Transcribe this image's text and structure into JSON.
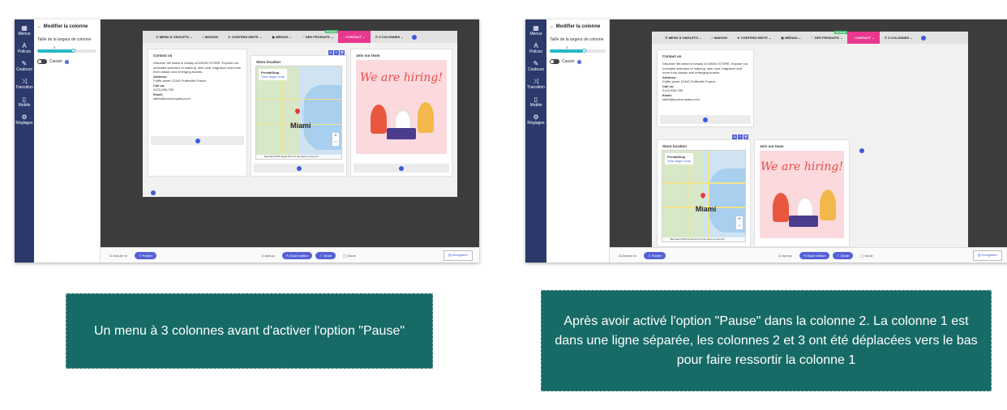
{
  "nav": [
    {
      "icon": "grid-icon",
      "glyph": "▦",
      "label": "Menus"
    },
    {
      "icon": "font-icon",
      "glyph": "A",
      "label": "Polices"
    },
    {
      "icon": "brush-icon",
      "glyph": "✎",
      "label": "Couleurs"
    },
    {
      "icon": "shuffle-icon",
      "glyph": "⤨",
      "label": "Transition"
    },
    {
      "icon": "mobile-icon",
      "glyph": "▯",
      "label": "Mobile"
    },
    {
      "icon": "gear-icon",
      "glyph": "⚙",
      "label": "Réglages"
    }
  ],
  "config": {
    "back_label": "← Modifier la colonne",
    "width_label": "Taille de la largeur de colonne",
    "width_value": "4",
    "width_fraction": 0.6,
    "break_label": "Casser"
  },
  "menu": {
    "items": [
      "☰ MENU À ONGLETS ⌄",
      "⌂ MAISON",
      "★ CONTENU MIXTE ⌄",
      "▣ MÉDIAS ⌄",
      "♡ DES PRODUITS ⌄",
      "◌ CONTACT ⌄",
      "☰ 3 COLONNES ⌄"
    ],
    "badge": "Nouveau"
  },
  "contact": {
    "title": "Contact us",
    "intro": "Discover the latest in beauty at DEMO STORE. Explore our unrivaled selection of makeup, skin care, fragrance and more from classic and emerging brands.",
    "address_label": "Address:",
    "address": "Puffin street 12345 Puffinville France",
    "call_label": "Call us:",
    "phone": "0123-456-789",
    "email_label": "Email:",
    "email": "sales@yourcompany.com"
  },
  "store": {
    "title": "Store location",
    "place": "PrestaShop",
    "link": "View larger map",
    "city": "Miami",
    "footer": "Map data ©2023 Google  Terms of Use  Report a map error"
  },
  "join": {
    "title": "Join our team",
    "hiring": "We are hiring!"
  },
  "bottom": {
    "undo": "⎌ Annuler le",
    "publish": "⇪ Publier",
    "preview": "◎ Aperçu",
    "edit_mode": "✎ Mode édition",
    "mode": "☾ Mode",
    "mode2": "◯ Mode",
    "save": "🖫 Enregistrer"
  },
  "captions": {
    "left": "Un menu à 3 colonnes avant d'activer l'option \"Pause\"",
    "right": "Après avoir activé l'option \"Pause\" dans la colonne 2. La colonne 1 est dans une ligne séparée, les colonnes 2 et 3 ont été déplacées vers le bas pour faire ressortir la colonne 1"
  },
  "colors": {
    "nav": "#2b3a6b",
    "accent": "#3b5bdb",
    "contact_tab": "#e8388f",
    "caption_bg": "#176b66"
  }
}
